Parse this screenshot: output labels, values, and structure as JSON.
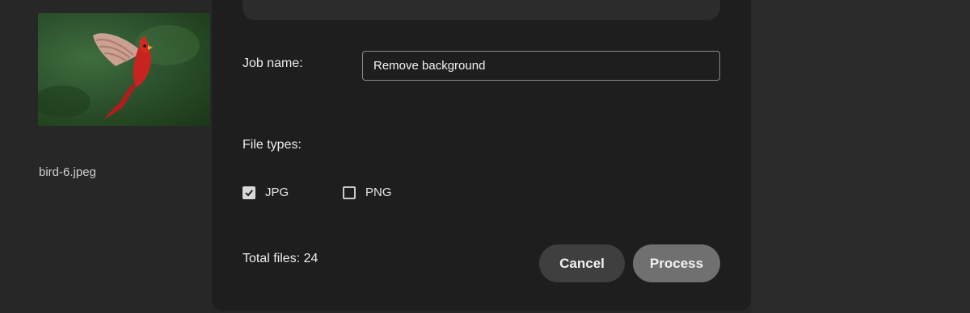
{
  "thumbnail": {
    "filename": "bird-6.jpeg",
    "image_icon": "cardinal-bird-photo"
  },
  "dialog": {
    "job_name_label": "Job name:",
    "job_name_value": "Remove background",
    "file_types_label": "File types:",
    "file_types": [
      {
        "label": "JPG",
        "checked": true
      },
      {
        "label": "PNG",
        "checked": false
      }
    ],
    "total_files": "Total files: 24",
    "cancel_label": "Cancel",
    "process_label": "Process"
  },
  "colors": {
    "background": "#262626",
    "dialog": "#1e1e1e",
    "cancel_button": "#3f3f3f",
    "process_button": "#707070",
    "bird_red": "#c8231f"
  }
}
